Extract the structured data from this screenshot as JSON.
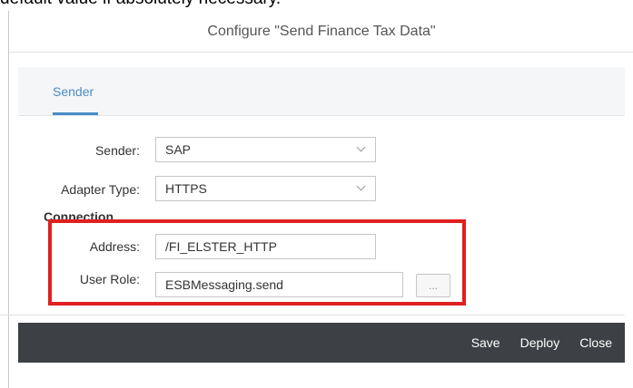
{
  "top_text": "default value if absolutely necessary.",
  "dialog": {
    "title": "Configure \"Send Finance Tax Data\""
  },
  "tabs": [
    {
      "label": "Sender",
      "active": true
    }
  ],
  "form": {
    "sender_label": "Sender:",
    "sender_value": "SAP",
    "adapter_label": "Adapter Type:",
    "adapter_value": "HTTPS",
    "connection_label": "Connection",
    "address_label": "Address:",
    "address_value": "/FI_ELSTER_HTTP",
    "role_label": "User Role:",
    "role_value": "ESBMessaging.send",
    "browse_label": "..."
  },
  "footer": {
    "save": "Save",
    "deploy": "Deploy",
    "close": "Close"
  },
  "colors": {
    "accent": "#4a8cc7",
    "highlight": "#e02020",
    "footer_bg": "#3d4044"
  }
}
